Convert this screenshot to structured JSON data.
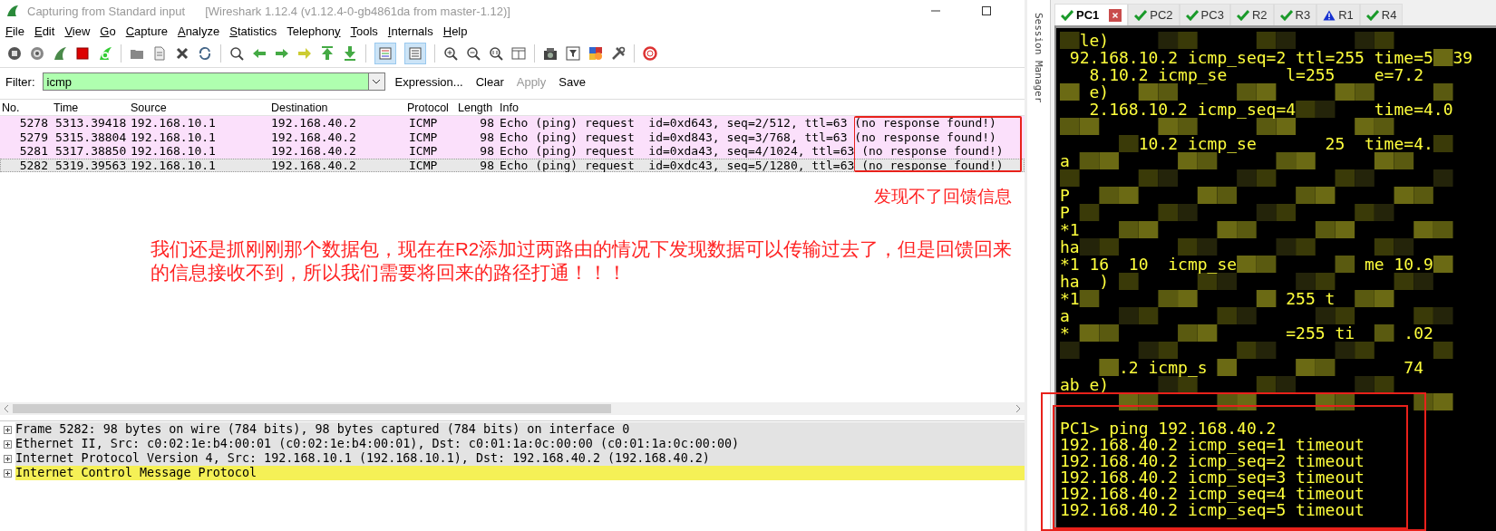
{
  "window": {
    "title": "Capturing from Standard input",
    "subtitle": "[Wireshark 1.12.4  (v1.12.4-0-gb4861da from master-1.12)]"
  },
  "menu": [
    {
      "first": "F",
      "rest": "ile"
    },
    {
      "first": "E",
      "rest": "dit"
    },
    {
      "first": "V",
      "rest": "iew"
    },
    {
      "first": "G",
      "rest": "o"
    },
    {
      "first": "C",
      "rest": "apture"
    },
    {
      "first": "A",
      "rest": "nalyze"
    },
    {
      "first": "S",
      "rest": "tatistics"
    },
    {
      "rest": "Telephon",
      "tail": "y"
    },
    {
      "first": "T",
      "rest": "ools"
    },
    {
      "first": "I",
      "rest": "nternals"
    },
    {
      "first": "H",
      "rest": "elp"
    }
  ],
  "toolbar": {
    "colorize": true,
    "auto_scroll": true
  },
  "filter": {
    "label": "Filter:",
    "value": "icmp",
    "valid": true,
    "buttons": [
      {
        "label": "Expression...",
        "disabled": false
      },
      {
        "label": "Clear",
        "disabled": false
      },
      {
        "label": "Apply",
        "disabled": true
      },
      {
        "label": "Save",
        "disabled": false
      }
    ]
  },
  "packet_list": {
    "columns": [
      "No.",
      "Time",
      "Source",
      "Destination",
      "Protocol",
      "Length",
      "Info"
    ],
    "rows": [
      {
        "no": "5278",
        "time": "5313.39418",
        "source": "192.168.10.1",
        "destination": "192.168.40.2",
        "protocol": "ICMP",
        "length": "98",
        "info": "Echo (ping) request  id=0xd643, seq=2/512, ttl=63 (no response found!)",
        "color": "#fbe0fb",
        "selected": false
      },
      {
        "no": "5279",
        "time": "5315.38804",
        "source": "192.168.10.1",
        "destination": "192.168.40.2",
        "protocol": "ICMP",
        "length": "98",
        "info": "Echo (ping) request  id=0xd843, seq=3/768, ttl=63 (no response found!)",
        "color": "#fbe0fb",
        "selected": false
      },
      {
        "no": "5281",
        "time": "5317.38850",
        "source": "192.168.10.1",
        "destination": "192.168.40.2",
        "protocol": "ICMP",
        "length": "98",
        "info": "Echo (ping) request  id=0xda43, seq=4/1024, ttl=63 (no response found!)",
        "color": "#fbe0fb",
        "selected": false
      },
      {
        "no": "5282",
        "time": "5319.39563",
        "source": "192.168.10.1",
        "destination": "192.168.40.2",
        "protocol": "ICMP",
        "length": "98",
        "info": "Echo (ping) request  id=0xdc43, seq=5/1280, ttl=63 (no response found!)",
        "color": "#e8e8e8",
        "selected": true
      }
    ]
  },
  "annotations": {
    "note": "发现不了回馈信息",
    "paragraph": "我们还是抓刚刚那个数据包，现在在R2添加过两路由的情况下发现数据可以传输过去了，但是回馈回来的信息接收不到，所以我们需要将回来的路径打通！！！"
  },
  "details": [
    {
      "text": "Frame 5282: 98 bytes on wire (784 bits), 98 bytes captured (784 bits) on interface 0",
      "selected": false
    },
    {
      "text": "Ethernet II, Src: c0:02:1e:b4:00:01 (c0:02:1e:b4:00:01), Dst: c0:01:1a:0c:00:00 (c0:01:1a:0c:00:00)",
      "selected": false
    },
    {
      "text": "Internet Protocol Version 4, Src: 192.168.10.1 (192.168.10.1), Dst: 192.168.40.2 (192.168.40.2)",
      "selected": false
    },
    {
      "text": "Internet Control Message Protocol",
      "selected": true
    }
  ],
  "session_manager": {
    "label": "Session Manager",
    "tabs": [
      {
        "label": "PC1",
        "kind": "ok",
        "selected": true
      },
      {
        "label": "PC2",
        "kind": "ok",
        "selected": false
      },
      {
        "label": "PC3",
        "kind": "ok",
        "selected": false
      },
      {
        "label": "R2",
        "kind": "ok",
        "selected": false
      },
      {
        "label": "R3",
        "kind": "ok",
        "selected": false
      },
      {
        "label": "R1",
        "kind": "warning",
        "selected": false
      },
      {
        "label": "R4",
        "kind": "ok",
        "selected": false
      }
    ]
  },
  "terminal": {
    "lines": [
      {
        "text": "  le)",
        "blank_after": false
      },
      {
        "text": " 92.168.10.2 icmp_seq=2 ttl=255 time=5  39",
        "blank_after": false
      },
      {
        "text": "   8.10.2 icmp_se      l=255    e=7.2",
        "blank_after": false
      },
      {
        "text": "   e)",
        "blank_after": false
      },
      {
        "text": "   2.168.10.2 icmp_seq=4        time=4.0",
        "blank_after": true
      },
      {
        "text": "        10.2 icmp_se       25  time=4.",
        "blank_after": false
      },
      {
        "text": "a",
        "blank_after": true
      },
      {
        "text": "P",
        "blank_after": false
      },
      {
        "text": "P",
        "blank_after": false
      },
      {
        "text": "*1",
        "blank_after": false
      },
      {
        "text": "ha",
        "blank_after": false
      },
      {
        "text": "*1 16  10  icmp_se             me 10.9",
        "blank_after": false
      },
      {
        "text": "ha  )",
        "blank_after": false
      },
      {
        "text": "*1                     255 t",
        "blank_after": false
      },
      {
        "text": "a",
        "blank_after": false
      },
      {
        "text": "*                      =255 ti     .02",
        "blank_after": true
      },
      {
        "text": "      .2 icmp_s                    74",
        "blank_after": false
      },
      {
        "text": "ab e)",
        "blank_after": false
      }
    ],
    "ping_block": [
      "PC1> ping 192.168.40.2",
      "192.168.40.2 icmp_seq=1 timeout",
      "192.168.40.2 icmp_seq=2 timeout",
      "192.168.40.2 icmp_seq=3 timeout",
      "192.168.40.2 icmp_seq=4 timeout",
      "192.168.40.2 icmp_seq=5 timeout"
    ]
  }
}
